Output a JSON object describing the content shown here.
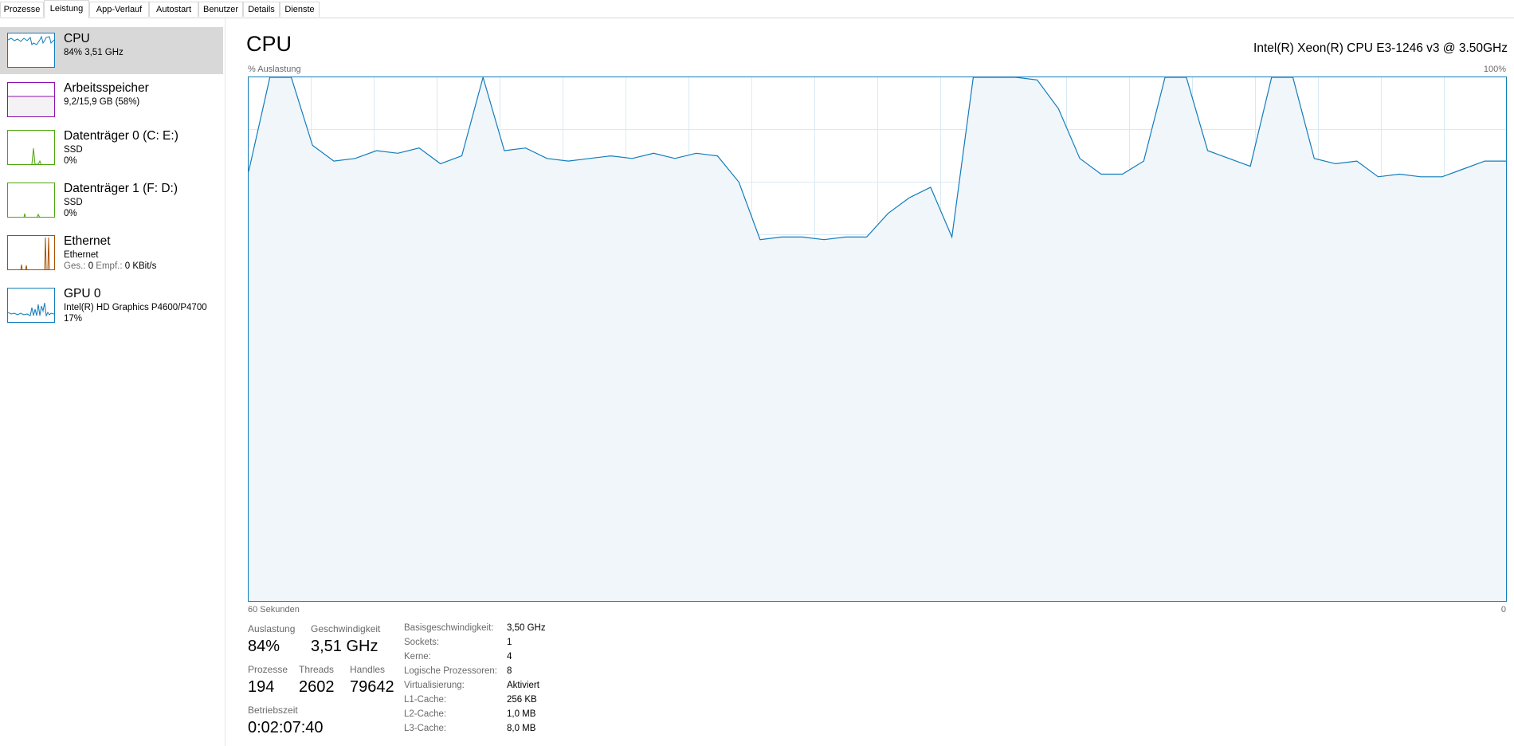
{
  "tabs": [
    "Prozesse",
    "Leistung",
    "App-Verlauf",
    "Autostart",
    "Benutzer",
    "Details",
    "Dienste"
  ],
  "active_tab": "Leistung",
  "sidebar": {
    "items": [
      {
        "title": "CPU",
        "line1": "84% 3,51 GHz",
        "line2": "",
        "color": "#117dbb",
        "fill": "#f1f6fa",
        "icon": "cpu-mini-graph"
      },
      {
        "title": "Arbeitsspeicher",
        "line1": "9,2/15,9 GB (58%)",
        "line2": "",
        "color": "#8b12ae",
        "fill": "#f4f2f4",
        "icon": "memory-mini-graph"
      },
      {
        "title": "Datenträger 0 (C: E:)",
        "line1": "SSD",
        "line2": "0%",
        "color": "#4da60c",
        "fill": "#ffffff",
        "icon": "disk-mini-graph"
      },
      {
        "title": "Datenträger 1 (F: D:)",
        "line1": "SSD",
        "line2": "0%",
        "color": "#4da60c",
        "fill": "#ffffff",
        "icon": "disk-mini-graph"
      },
      {
        "title": "Ethernet",
        "line1": "Ethernet",
        "line2_label_send": "Ges.:",
        "line2_send": "0",
        "line2_label_recv": "Empf.:",
        "line2_recv": "0 KBit/s",
        "color": "#a74f01",
        "fill": "#ffffff",
        "icon": "network-mini-graph"
      },
      {
        "title": "GPU 0",
        "line1": "Intel(R) HD Graphics P4600/P4700",
        "line2": "17%",
        "color": "#117dbb",
        "fill": "#f1f6fa",
        "icon": "gpu-mini-graph"
      }
    ]
  },
  "main": {
    "title": "CPU",
    "cpu_model": "Intel(R) Xeon(R) CPU E3-1246 v3 @ 3.50GHz",
    "y_axis_label": "% Auslastung",
    "y_axis_max": "100%",
    "x_axis_label": "60 Sekunden",
    "x_axis_min": "0"
  },
  "stats": {
    "utilization_label": "Auslastung",
    "utilization": "84%",
    "speed_label": "Geschwindigkeit",
    "speed": "3,51 GHz",
    "processes_label": "Prozesse",
    "processes": "194",
    "threads_label": "Threads",
    "threads": "2602",
    "handles_label": "Handles",
    "handles": "79642",
    "uptime_label": "Betriebszeit",
    "uptime": "0:02:07:40"
  },
  "info": [
    {
      "key": "Basisgeschwindigkeit:",
      "value": "3,50 GHz"
    },
    {
      "key": "Sockets:",
      "value": "1"
    },
    {
      "key": "Kerne:",
      "value": "4"
    },
    {
      "key": "Logische Prozessoren:",
      "value": "8"
    },
    {
      "key": "Virtualisierung:",
      "value": "Aktiviert"
    },
    {
      "key": "L1-Cache:",
      "value": "256 KB"
    },
    {
      "key": "L2-Cache:",
      "value": "1,0 MB"
    },
    {
      "key": "L3-Cache:",
      "value": "8,0 MB"
    }
  ],
  "colors": {
    "cpu_line": "#117dbb",
    "cpu_fill": "#f1f6fa",
    "cpu_grid": "#d9eaf4"
  },
  "chart_data": {
    "type": "area",
    "xlabel": "60 Sekunden",
    "ylabel": "% Auslastung",
    "xlim": [
      60,
      0
    ],
    "ylim": [
      0,
      100
    ],
    "grid": true,
    "series": [
      {
        "values": [
          82,
          100,
          100,
          87,
          84,
          84.5,
          86,
          85.5,
          86.5,
          83.5,
          85,
          100,
          86,
          86.5,
          84.5,
          84,
          84.5,
          85,
          84.5,
          85.5,
          84.5,
          85.5,
          85,
          80,
          69,
          69.5,
          69.5,
          69,
          69.5,
          69.5,
          74,
          77,
          79,
          69.5,
          100,
          100,
          100,
          99.5,
          94,
          84.5,
          81.5,
          81.5,
          84,
          100,
          100,
          86,
          84.5,
          83,
          100,
          100,
          84.5,
          83.5,
          84,
          81,
          81.5,
          81,
          81,
          82.5,
          84,
          84
        ]
      }
    ]
  }
}
